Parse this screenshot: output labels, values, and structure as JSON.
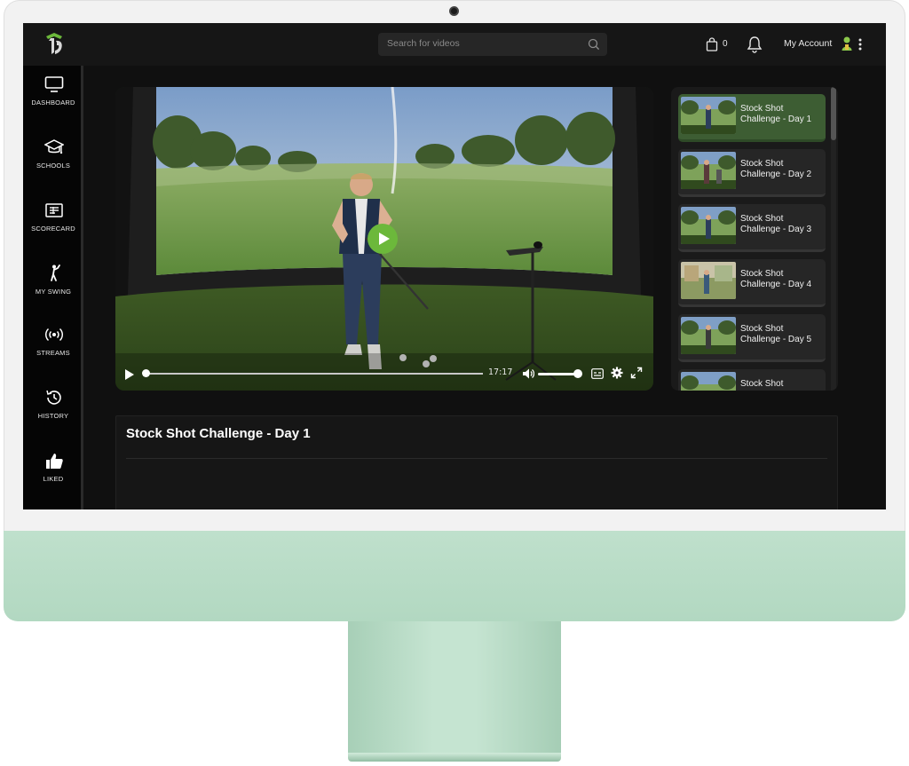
{
  "header": {
    "search_placeholder": "Search for videos",
    "cart_count": "0",
    "account_label": "My Account"
  },
  "sidebar": {
    "items": [
      {
        "label": "DASHBOARD",
        "icon": "monitor-icon"
      },
      {
        "label": "SCHOOLS",
        "icon": "graduation-cap-icon"
      },
      {
        "label": "SCORECARD",
        "icon": "scorecard-icon"
      },
      {
        "label": "MY SWING",
        "icon": "golfer-icon"
      },
      {
        "label": "STREAMS",
        "icon": "broadcast-icon"
      },
      {
        "label": "HISTORY",
        "icon": "history-icon"
      },
      {
        "label": "LIKED",
        "icon": "thumbs-up-icon"
      }
    ]
  },
  "player": {
    "time": "17:17",
    "progress": 0,
    "volume": 1
  },
  "playlist": {
    "items": [
      {
        "title": "Stock Shot Challenge - Day 1",
        "active": true
      },
      {
        "title": "Stock Shot Challenge - Day 2",
        "active": false
      },
      {
        "title": "Stock Shot Challenge - Day 3",
        "active": false
      },
      {
        "title": "Stock Shot Challenge - Day 4",
        "active": false
      },
      {
        "title": "Stock Shot Challenge - Day 5",
        "active": false
      },
      {
        "title": "Stock Shot",
        "active": false
      }
    ]
  },
  "video": {
    "title": "Stock Shot Challenge - Day 1"
  },
  "colors": {
    "accent_green": "#6cb83b",
    "active_item": "#3d5d33",
    "monitor_chin": "#b8dcc6"
  }
}
